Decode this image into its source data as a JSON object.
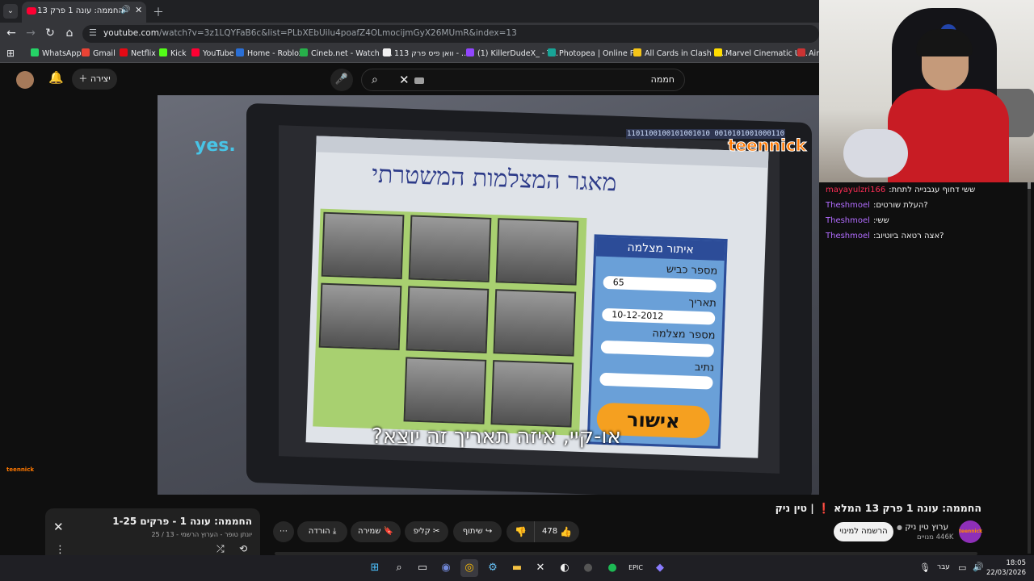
{
  "browser": {
    "tab_title": "החממה: עונה 1 פרק 13 המ",
    "url_host": "youtube.com",
    "url_path": "/watch?v=3z1LQYFaB6c&list=PLbXEbUilu4poafZ4OLmocijmGyX26MUmR&index=13",
    "bookmarks": [
      "WhatsApp",
      "Gmail",
      "Netflix",
      "Kick",
      "YouTube",
      "Home - Roblox",
      "Cineb.net - Watch F...",
      "וואן פיס פרק 113 - ...",
      "(1) KillerDudeX_ - T...",
      "Photopea | Online P...",
      "All Cards in Clash R...",
      "Marvel Cinematic U...",
      "Aim"
    ],
    "bookmark_colors": [
      "#25d366",
      "#ea4335",
      "#e50914",
      "#53fc18",
      "#ff0033",
      "#2a6fd6",
      "#27b04a",
      "#f1f1f1",
      "#9146ff",
      "#18a497",
      "#f5c518",
      "#ffdd00",
      "#cc3333"
    ]
  },
  "youtube": {
    "create_label": "יצירה",
    "search_query": "חממה",
    "video_title": "החממה: עונה 1 פרק 13 המלא ❗ | טין ניק",
    "channel_name": "ערוץ טין ניק",
    "channel_subs": "446K מנויים",
    "channel_avatar_text": "teennick",
    "subscribe_label": "הרשמה למינוי",
    "likes": "478",
    "share_label": "שיתוף",
    "clip_label": "קליפ",
    "save_label": "שמירה",
    "download_label": "הורדה",
    "more_label": "⋯"
  },
  "video_frame": {
    "yes_logo": "yes.",
    "teennick_logo": "teennick",
    "binary_text": "1101100100101001010 0010101001000110",
    "page_title": "מאגר המצלמות המשטרתי",
    "form_title": "איתור מצלמה",
    "form_labels": [
      "מספר כביש",
      "תאריך",
      "מספר מצלמה",
      "נתיב"
    ],
    "road_value": "65",
    "date_value": "10-12-2012",
    "confirm_button": "אישור",
    "subtitle": "או-קיי, איזה תאריך זה יוצא?",
    "corner_logo": "teennick"
  },
  "playlist": {
    "title": "החממה: עונה 1 - פרקים 1-25",
    "subtitle": "יונתן טופר - הערוץ הרשמי - 13 / 25"
  },
  "chat": [
    {
      "user": "mayayulzri166",
      "message": ":ששי דחוף עגבנייה לתחת",
      "user_color": "red"
    },
    {
      "user": "Theshmoel",
      "message": ":העלת שורטים?",
      "user_color": "purple"
    },
    {
      "user": "Theshmoel",
      "message": ":ששי",
      "user_color": "purple"
    },
    {
      "user": "Theshmoel",
      "message": ":אצה רטאה ביוטיוב?",
      "user_color": "purple"
    }
  ],
  "taskbar": {
    "lang": "עבר",
    "time": "18:05",
    "date": "22/03/2026"
  }
}
